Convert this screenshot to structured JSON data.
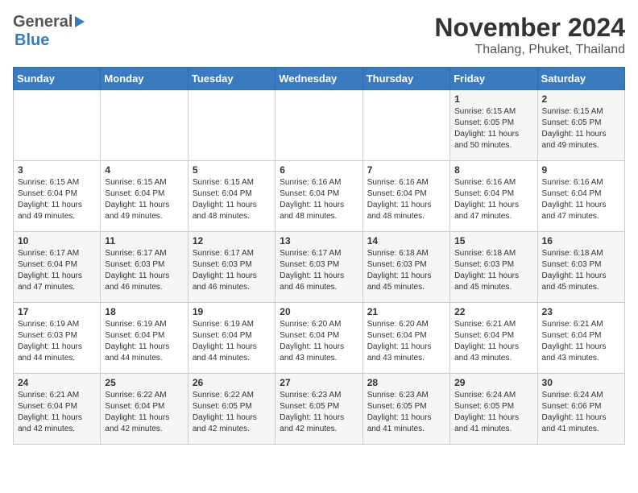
{
  "header": {
    "logo_general": "General",
    "logo_blue": "Blue",
    "title": "November 2024",
    "subtitle": "Thalang, Phuket, Thailand"
  },
  "weekdays": [
    "Sunday",
    "Monday",
    "Tuesday",
    "Wednesday",
    "Thursday",
    "Friday",
    "Saturday"
  ],
  "weeks": [
    [
      {
        "day": "",
        "info": ""
      },
      {
        "day": "",
        "info": ""
      },
      {
        "day": "",
        "info": ""
      },
      {
        "day": "",
        "info": ""
      },
      {
        "day": "",
        "info": ""
      },
      {
        "day": "1",
        "info": "Sunrise: 6:15 AM\nSunset: 6:05 PM\nDaylight: 11 hours\nand 50 minutes."
      },
      {
        "day": "2",
        "info": "Sunrise: 6:15 AM\nSunset: 6:05 PM\nDaylight: 11 hours\nand 49 minutes."
      }
    ],
    [
      {
        "day": "3",
        "info": "Sunrise: 6:15 AM\nSunset: 6:04 PM\nDaylight: 11 hours\nand 49 minutes."
      },
      {
        "day": "4",
        "info": "Sunrise: 6:15 AM\nSunset: 6:04 PM\nDaylight: 11 hours\nand 49 minutes."
      },
      {
        "day": "5",
        "info": "Sunrise: 6:15 AM\nSunset: 6:04 PM\nDaylight: 11 hours\nand 48 minutes."
      },
      {
        "day": "6",
        "info": "Sunrise: 6:16 AM\nSunset: 6:04 PM\nDaylight: 11 hours\nand 48 minutes."
      },
      {
        "day": "7",
        "info": "Sunrise: 6:16 AM\nSunset: 6:04 PM\nDaylight: 11 hours\nand 48 minutes."
      },
      {
        "day": "8",
        "info": "Sunrise: 6:16 AM\nSunset: 6:04 PM\nDaylight: 11 hours\nand 47 minutes."
      },
      {
        "day": "9",
        "info": "Sunrise: 6:16 AM\nSunset: 6:04 PM\nDaylight: 11 hours\nand 47 minutes."
      }
    ],
    [
      {
        "day": "10",
        "info": "Sunrise: 6:17 AM\nSunset: 6:04 PM\nDaylight: 11 hours\nand 47 minutes."
      },
      {
        "day": "11",
        "info": "Sunrise: 6:17 AM\nSunset: 6:03 PM\nDaylight: 11 hours\nand 46 minutes."
      },
      {
        "day": "12",
        "info": "Sunrise: 6:17 AM\nSunset: 6:03 PM\nDaylight: 11 hours\nand 46 minutes."
      },
      {
        "day": "13",
        "info": "Sunrise: 6:17 AM\nSunset: 6:03 PM\nDaylight: 11 hours\nand 46 minutes."
      },
      {
        "day": "14",
        "info": "Sunrise: 6:18 AM\nSunset: 6:03 PM\nDaylight: 11 hours\nand 45 minutes."
      },
      {
        "day": "15",
        "info": "Sunrise: 6:18 AM\nSunset: 6:03 PM\nDaylight: 11 hours\nand 45 minutes."
      },
      {
        "day": "16",
        "info": "Sunrise: 6:18 AM\nSunset: 6:03 PM\nDaylight: 11 hours\nand 45 minutes."
      }
    ],
    [
      {
        "day": "17",
        "info": "Sunrise: 6:19 AM\nSunset: 6:03 PM\nDaylight: 11 hours\nand 44 minutes."
      },
      {
        "day": "18",
        "info": "Sunrise: 6:19 AM\nSunset: 6:04 PM\nDaylight: 11 hours\nand 44 minutes."
      },
      {
        "day": "19",
        "info": "Sunrise: 6:19 AM\nSunset: 6:04 PM\nDaylight: 11 hours\nand 44 minutes."
      },
      {
        "day": "20",
        "info": "Sunrise: 6:20 AM\nSunset: 6:04 PM\nDaylight: 11 hours\nand 43 minutes."
      },
      {
        "day": "21",
        "info": "Sunrise: 6:20 AM\nSunset: 6:04 PM\nDaylight: 11 hours\nand 43 minutes."
      },
      {
        "day": "22",
        "info": "Sunrise: 6:21 AM\nSunset: 6:04 PM\nDaylight: 11 hours\nand 43 minutes."
      },
      {
        "day": "23",
        "info": "Sunrise: 6:21 AM\nSunset: 6:04 PM\nDaylight: 11 hours\nand 43 minutes."
      }
    ],
    [
      {
        "day": "24",
        "info": "Sunrise: 6:21 AM\nSunset: 6:04 PM\nDaylight: 11 hours\nand 42 minutes."
      },
      {
        "day": "25",
        "info": "Sunrise: 6:22 AM\nSunset: 6:04 PM\nDaylight: 11 hours\nand 42 minutes."
      },
      {
        "day": "26",
        "info": "Sunrise: 6:22 AM\nSunset: 6:05 PM\nDaylight: 11 hours\nand 42 minutes."
      },
      {
        "day": "27",
        "info": "Sunrise: 6:23 AM\nSunset: 6:05 PM\nDaylight: 11 hours\nand 42 minutes."
      },
      {
        "day": "28",
        "info": "Sunrise: 6:23 AM\nSunset: 6:05 PM\nDaylight: 11 hours\nand 41 minutes."
      },
      {
        "day": "29",
        "info": "Sunrise: 6:24 AM\nSunset: 6:05 PM\nDaylight: 11 hours\nand 41 minutes."
      },
      {
        "day": "30",
        "info": "Sunrise: 6:24 AM\nSunset: 6:06 PM\nDaylight: 11 hours\nand 41 minutes."
      }
    ]
  ]
}
